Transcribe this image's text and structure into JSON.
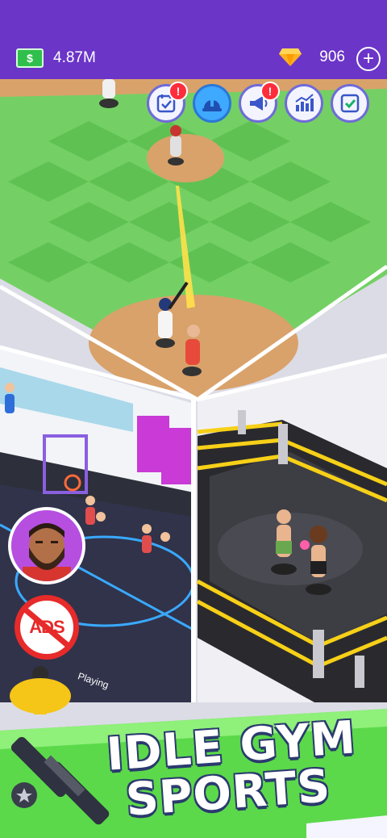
{
  "header": {
    "cash": "4.87M",
    "cash_icon": "money-icon",
    "gems": "906",
    "gem_icon": "diamond-icon",
    "add_icon": "plus-icon"
  },
  "toolbar": [
    {
      "icon": "checklist-icon",
      "alert": "!"
    },
    {
      "icon": "hardhat-icon",
      "alert": ""
    },
    {
      "icon": "megaphone-icon",
      "alert": "!"
    },
    {
      "icon": "stats-icon",
      "alert": ""
    },
    {
      "icon": "checkbox-icon",
      "alert": ""
    }
  ],
  "scene": {
    "no_ads_label": "ADS",
    "playing_label": "Playing"
  },
  "banner": {
    "line1": "IDLE GYM",
    "line2": "SPORTS"
  },
  "colors": {
    "header_bg": "#6b35c8",
    "field_green": "#6fcf62",
    "dirt": "#d9a26a",
    "banner_green": "#58d94a"
  }
}
